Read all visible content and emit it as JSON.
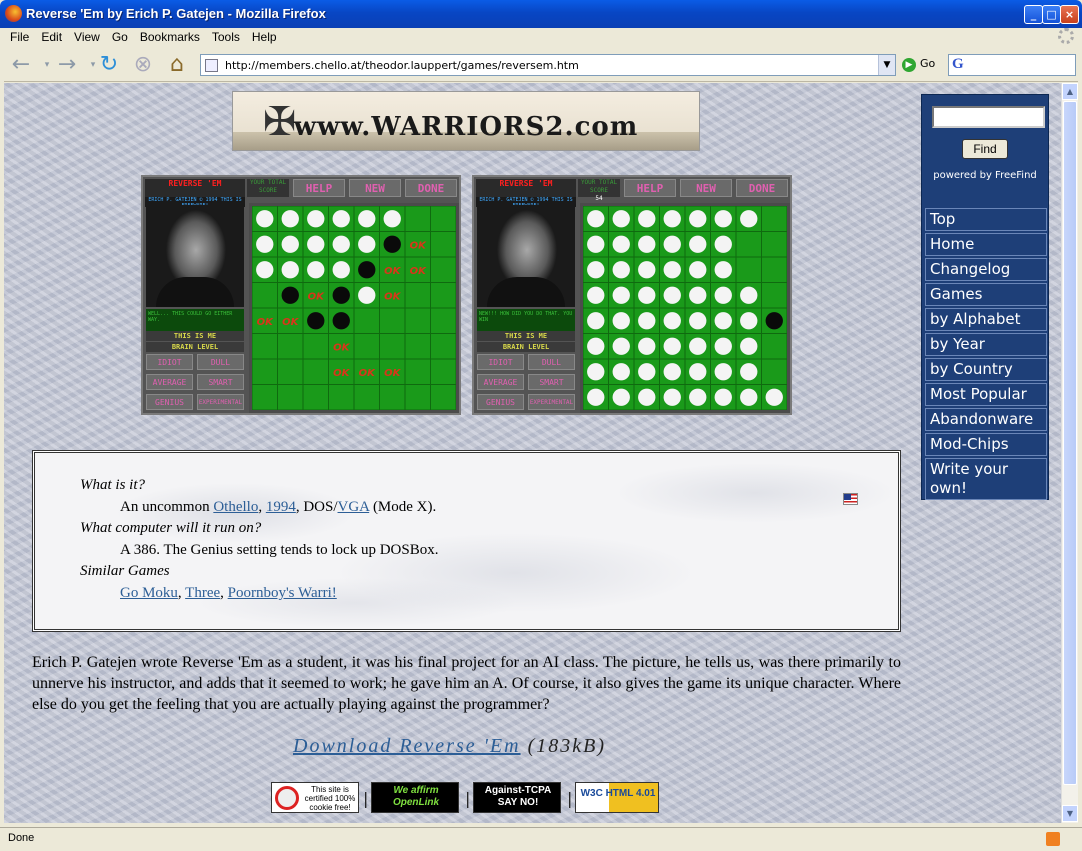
{
  "window": {
    "title": "Reverse 'Em by Erich P. Gatejen - Mozilla Firefox",
    "minimize": "_",
    "maximize": "□",
    "close": "×"
  },
  "menu": [
    "File",
    "Edit",
    "View",
    "Go",
    "Bookmarks",
    "Tools",
    "Help"
  ],
  "nav": {
    "url": "http://members.chello.at/theodor.lauppert/games/reversem.htm",
    "go_label": "Go",
    "icons": [
      "back-icon",
      "forward-icon",
      "reload-icon",
      "stop-icon",
      "home-icon"
    ]
  },
  "banner": {
    "text": "www.WARRIORS2.com"
  },
  "shots": [
    {
      "title": "REVERSE 'EM",
      "subtitle": "ERICH P. GATEJEN © 1994 THIS IS FREEWARE!",
      "score_label": "YOUR TOTAL SCORE",
      "score": "",
      "speech": "WELL... THIS COULD GO EITHER WAY.",
      "buttons": [
        "HELP",
        "NEW",
        "DONE"
      ],
      "this_is_me": "THIS IS ME",
      "brain_level": "BRAIN LEVEL",
      "levels": [
        "IDIOT",
        "DULL",
        "AVERAGE",
        "SMART",
        "GENIUS",
        "EXPERIMENTAL"
      ]
    },
    {
      "title": "REVERSE 'EM",
      "subtitle": "ERICH P. GATEJEN © 1994 THIS IS FREEWARE!",
      "score_label": "YOUR TOTAL SCORE",
      "score": "54",
      "speech": "NEW!!! HOW DID YOU DO THAT. YOU WIN",
      "buttons": [
        "HELP",
        "NEW",
        "DONE"
      ],
      "this_is_me": "THIS IS ME",
      "brain_level": "BRAIN LEVEL",
      "levels": [
        "IDIOT",
        "DULL",
        "AVERAGE",
        "SMART",
        "GENIUS",
        "EXPERIMENTAL"
      ]
    }
  ],
  "info": {
    "q1": "What is it?",
    "a1_prefix": "An uncommon",
    "a1_links": [
      "Othello",
      "1994"
    ],
    "a1_dos": "DOS/",
    "a1_vga": "VGA",
    "a1_suffix": "(Mode X).",
    "q2": "What computer will it run on?",
    "a2": "A 386. The Genius setting tends to lock up DOSBox.",
    "q3": "Similar Games",
    "similar": [
      "Go Moku",
      "Three",
      "Poornboy's Warri!"
    ]
  },
  "description": "Erich P. Gatejen wrote Reverse 'Em as a student, it was his final project for an AI class. The picture, he tells us, was there primarily to unnerve his instructor, and adds that it seemed to work; he gave him an A. Of course, it also gives the game its unique character. Where else do you get the feeling that you are actually playing against the programmer?",
  "download": {
    "link": "Download Reverse 'Em",
    "size": "(183kB)"
  },
  "badges": [
    {
      "text": "This site is certified 100% cookie free!"
    },
    {
      "text": "We affirm OpenLink"
    },
    {
      "text": "Against-TCPA SAY NO!"
    },
    {
      "text": "W3C HTML 4.01"
    }
  ],
  "sidebar": {
    "find": "Find",
    "powered": "powered by FreeFind",
    "items": [
      "Top",
      "Home",
      "Changelog",
      "Games",
      "by Alphabet",
      "by Year",
      "by Country",
      "Most Popular",
      "Abandonware",
      "Mod-Chips",
      "Write your own!"
    ]
  },
  "status": {
    "text": "Done"
  },
  "colors": {
    "sidebar_bg": "#1e3f78",
    "link": "#2c5e96",
    "board_green": "#1a9a1a"
  },
  "boards": [
    {
      "rows": [
        "WWWWWW..",
        "WWWWWBx.",
        "WWWWBxx.",
        ".BxBWx..",
        "xxBB....",
        "...x....",
        "...xxx..",
        "........"
      ]
    },
    {
      "rows": [
        "WWWWWWW.",
        "WWWWWW..",
        "WWWWWW..",
        "WWWWWWW.",
        "WWWWWWWB",
        "WWWWWWW.",
        "WWWWWWW.",
        "WWWWWWWW"
      ]
    }
  ]
}
